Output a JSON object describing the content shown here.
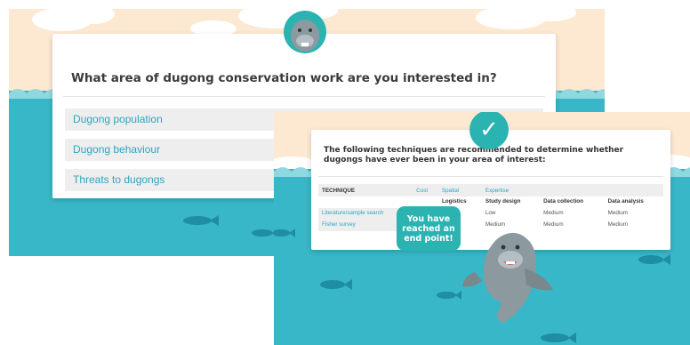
{
  "colors": {
    "sky": "#fde9d2",
    "sea": "#37b7c7",
    "sea_deep": "#2fa6bb",
    "accent": "#2ab3b1",
    "link": "#2ea4c3",
    "fish": "#1f8da3"
  },
  "quiz": {
    "question": "What area of dugong conservation work are you interested in?",
    "options": [
      {
        "label": "Dugong population"
      },
      {
        "label": "Dugong behaviour"
      },
      {
        "label": "Threats to dugongs"
      }
    ]
  },
  "result": {
    "icon": "check-circle-icon",
    "heading": "The following techniques are recommended to determine whether dugongs have ever been in your area of interest:",
    "badge": "You have reached an end point!",
    "table": {
      "headers": [
        "TECHNIQUE",
        "Cost",
        "Spatial",
        "Expertise"
      ],
      "subheaders": [
        "Logistics",
        "Study design",
        "Data collection",
        "Data analysis"
      ],
      "rows": [
        {
          "technique": "Literature/sample search",
          "partial": "Lo",
          "study_design": "Low",
          "data_collection": "Medium",
          "data_analysis": "Medium"
        },
        {
          "technique": "Fisher survey",
          "partial": "Lo",
          "study_design": "Medium",
          "data_collection": "Medium",
          "data_analysis": "Medium"
        }
      ]
    }
  }
}
